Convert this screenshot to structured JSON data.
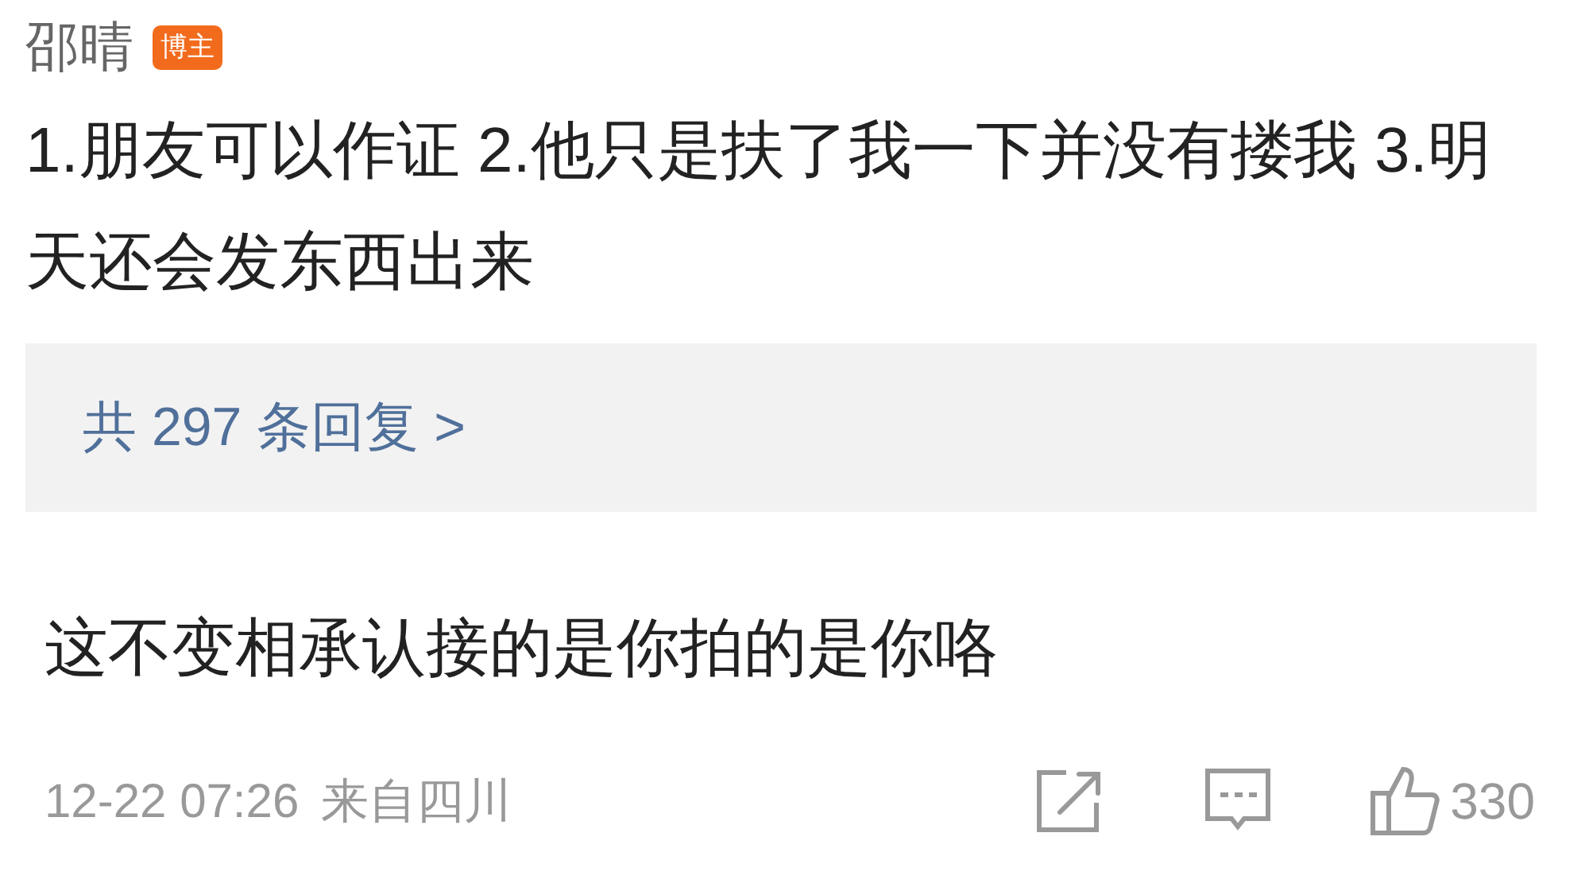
{
  "post": {
    "author": "邵晴",
    "badge": "博主",
    "text": "1.朋友可以作证 2.他只是扶了我一下并没有搂我 3.明天还会发东西出来"
  },
  "replies_link": "共 297 条回复 >",
  "comment": {
    "text": "这不变相承认接的是你拍的是你咯",
    "time": "12-22 07:26",
    "location": "来自四川",
    "likes": "330"
  }
}
